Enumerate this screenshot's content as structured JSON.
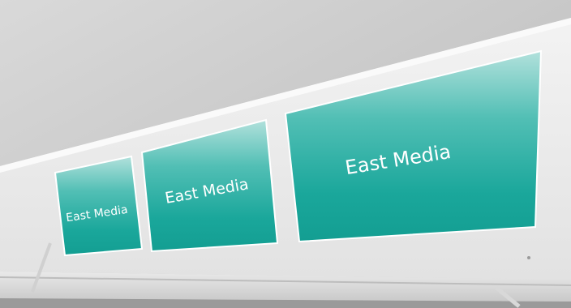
{
  "scene": {
    "description_type": "photo",
    "colors": {
      "ceiling_light": "#d6d6d6",
      "ceiling_dark": "#b9b9b9",
      "panel_face": "#eeeeee",
      "panel_shadow": "#cfcfcf",
      "screen_top": "#a6dcd6",
      "screen_mid": "#3fb7ad",
      "screen_bottom": "#12a195",
      "screen_border": "#1b8a80",
      "sign_text": "#ffffff"
    }
  },
  "screens": [
    {
      "label": "East Media"
    },
    {
      "label": "East Media"
    },
    {
      "label": "East Media"
    }
  ]
}
